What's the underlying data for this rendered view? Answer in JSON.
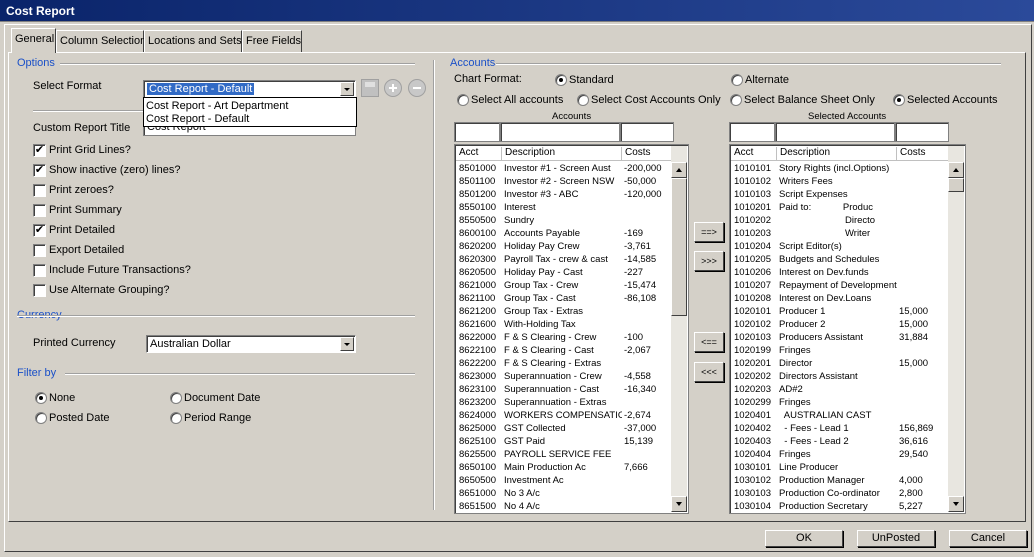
{
  "window": {
    "title": "Cost Report"
  },
  "tabs": [
    "General",
    "Column Selection",
    "Locations and Sets",
    "Free Fields"
  ],
  "options": {
    "heading": "Options",
    "select_format_label": "Select Format",
    "select_format_value": "Cost Report - Default",
    "format_options": [
      "Cost Report - Art Department",
      "Cost Report - Default"
    ],
    "custom_title_label": "Custom Report Title",
    "custom_title_value": "Cost Report",
    "checkboxes": [
      {
        "label": "Print Grid Lines?",
        "checked": true
      },
      {
        "label": "Show inactive (zero) lines?",
        "checked": true
      },
      {
        "label": "Print zeroes?",
        "checked": false
      },
      {
        "label": "Print Summary",
        "checked": false
      },
      {
        "label": "Print Detailed",
        "checked": true
      },
      {
        "label": "Export Detailed",
        "checked": false
      },
      {
        "label": "Include Future Transactions?",
        "checked": false
      },
      {
        "label": "Use Alternate Grouping?",
        "checked": false
      }
    ]
  },
  "currency": {
    "heading": "Currency",
    "label": "Printed Currency",
    "value": "Australian Dollar"
  },
  "filter": {
    "heading": "Filter by",
    "radios": [
      {
        "label": "None",
        "selected": true
      },
      {
        "label": "Document Date",
        "selected": false
      },
      {
        "label": "Posted Date",
        "selected": false
      },
      {
        "label": "Period Range",
        "selected": false
      }
    ]
  },
  "accounts": {
    "heading": "Accounts",
    "chart_format_label": "Chart Format:",
    "standard_label": "Standard",
    "alternate_label": "Alternate",
    "select_all": "Select All accounts",
    "select_cost": "Select Cost Accounts Only",
    "select_balance": "Select Balance Sheet Only",
    "selected_accounts": "Selected Accounts",
    "left_caption": "Accounts",
    "right_caption": "Selected Accounts",
    "columns": [
      "Acct",
      "Description",
      "Costs"
    ],
    "left_rows": [
      [
        "8501000",
        "Investor #1 - Screen Aust",
        "-200,000"
      ],
      [
        "8501100",
        "Investor #2 - Screen NSW",
        "-50,000"
      ],
      [
        "8501200",
        "Investor #3 - ABC",
        "-120,000"
      ],
      [
        "8550100",
        "Interest",
        ""
      ],
      [
        "8550500",
        "Sundry",
        ""
      ],
      [
        "8600100",
        "Accounts Payable",
        "-169"
      ],
      [
        "8620200",
        "Holiday Pay Crew",
        "-3,761"
      ],
      [
        "8620300",
        "Payroll Tax - crew & cast",
        "-14,585"
      ],
      [
        "8620500",
        "Holiday Pay - Cast",
        "-227"
      ],
      [
        "8621000",
        "Group Tax - Crew",
        "-15,474"
      ],
      [
        "8621100",
        "Group Tax - Cast",
        "-86,108"
      ],
      [
        "8621200",
        "Group Tax - Extras",
        ""
      ],
      [
        "8621600",
        "With-Holding Tax",
        ""
      ],
      [
        "8622000",
        "F & S Clearing - Crew",
        "-100"
      ],
      [
        "8622100",
        "F & S Clearing - Cast",
        "-2,067"
      ],
      [
        "8622200",
        "F & S Clearing - Extras",
        ""
      ],
      [
        "8623000",
        "Superannuation - Crew",
        "-4,558"
      ],
      [
        "8623100",
        "Superannuation - Cast",
        "-16,340"
      ],
      [
        "8623200",
        "Superannuation - Extras",
        ""
      ],
      [
        "8624000",
        "WORKERS COMPENSATIO",
        "-2,674"
      ],
      [
        "8625000",
        "GST Collected",
        "-37,000"
      ],
      [
        "8625100",
        "GST Paid",
        "15,139"
      ],
      [
        "8625500",
        "PAYROLL SERVICE FEE",
        ""
      ],
      [
        "8650100",
        "Main Production Ac",
        "7,666"
      ],
      [
        "8650500",
        "Investment Ac",
        ""
      ],
      [
        "8651000",
        "No 3 A/c",
        ""
      ],
      [
        "8651500",
        "No 4 A/c",
        ""
      ]
    ],
    "right_rows": [
      [
        "1010101",
        "Story Rights (incl.Options)",
        ""
      ],
      [
        "1010102",
        "Writers Fees",
        ""
      ],
      [
        "1010103",
        "Script Expenses",
        ""
      ],
      [
        "1010201",
        "Paid to:            Produc",
        ""
      ],
      [
        "1010202",
        "                         Directo",
        ""
      ],
      [
        "1010203",
        "                         Writer",
        ""
      ],
      [
        "1010204",
        "Script Editor(s)",
        ""
      ],
      [
        "1010205",
        "Budgets and Schedules",
        ""
      ],
      [
        "1010206",
        "Interest on Dev.funds",
        ""
      ],
      [
        "1010207",
        "Repayment of Development",
        ""
      ],
      [
        "1010208",
        "Interest on Dev.Loans",
        ""
      ],
      [
        "1020101",
        "Producer 1",
        "15,000"
      ],
      [
        "1020102",
        "Producer 2",
        "15,000"
      ],
      [
        "1020103",
        "Producers Assistant",
        "31,884"
      ],
      [
        "1020199",
        "Fringes",
        ""
      ],
      [
        "1020201",
        "Director",
        "15,000"
      ],
      [
        "1020202",
        "Directors Assistant",
        ""
      ],
      [
        "1020203",
        "AD#2",
        ""
      ],
      [
        "1020299",
        "Fringes",
        ""
      ],
      [
        "1020401",
        "  AUSTRALIAN CAST",
        ""
      ],
      [
        "1020402",
        "  - Fees - Lead 1",
        "156,869"
      ],
      [
        "1020403",
        "  - Fees - Lead 2",
        "36,616"
      ],
      [
        "1020404",
        "Fringes",
        "29,540"
      ],
      [
        "1030101",
        "Line Producer",
        ""
      ],
      [
        "1030102",
        "Production Manager",
        "4,000"
      ],
      [
        "1030103",
        "Production Co-ordinator",
        "2,800"
      ],
      [
        "1030104",
        "Production Secretary",
        "5,227"
      ]
    ],
    "move_buttons": [
      "==>",
      ">>>",
      "<==",
      "<<<"
    ]
  },
  "footer": {
    "ok": "OK",
    "unposted": "UnPosted",
    "cancel": "Cancel"
  }
}
